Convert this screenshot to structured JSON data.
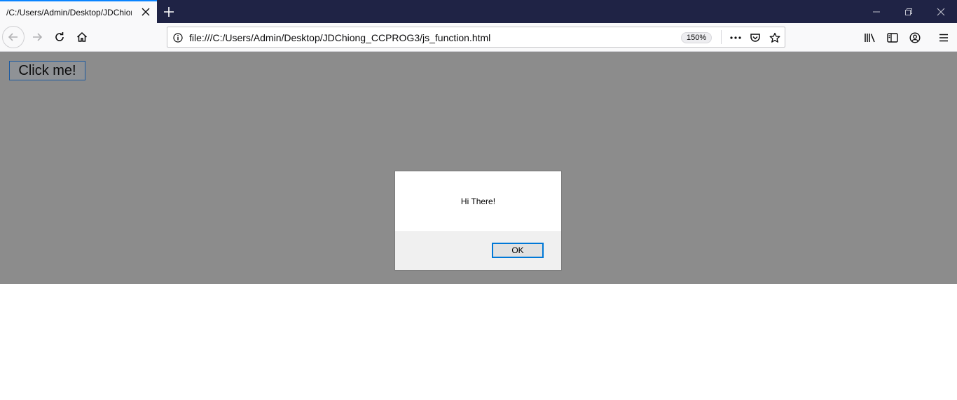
{
  "browser": {
    "tab_title": "/C:/Users/Admin/Desktop/JDChiong",
    "url": "file:///C:/Users/Admin/Desktop/JDChiong_CCPROG3/js_function.html",
    "zoom": "150%",
    "accent_color": "#0a84ff",
    "titlebar_color": "#1f2345"
  },
  "page": {
    "button_label": "Click me!"
  },
  "alert": {
    "message": "Hi There!",
    "ok_label": "OK"
  }
}
